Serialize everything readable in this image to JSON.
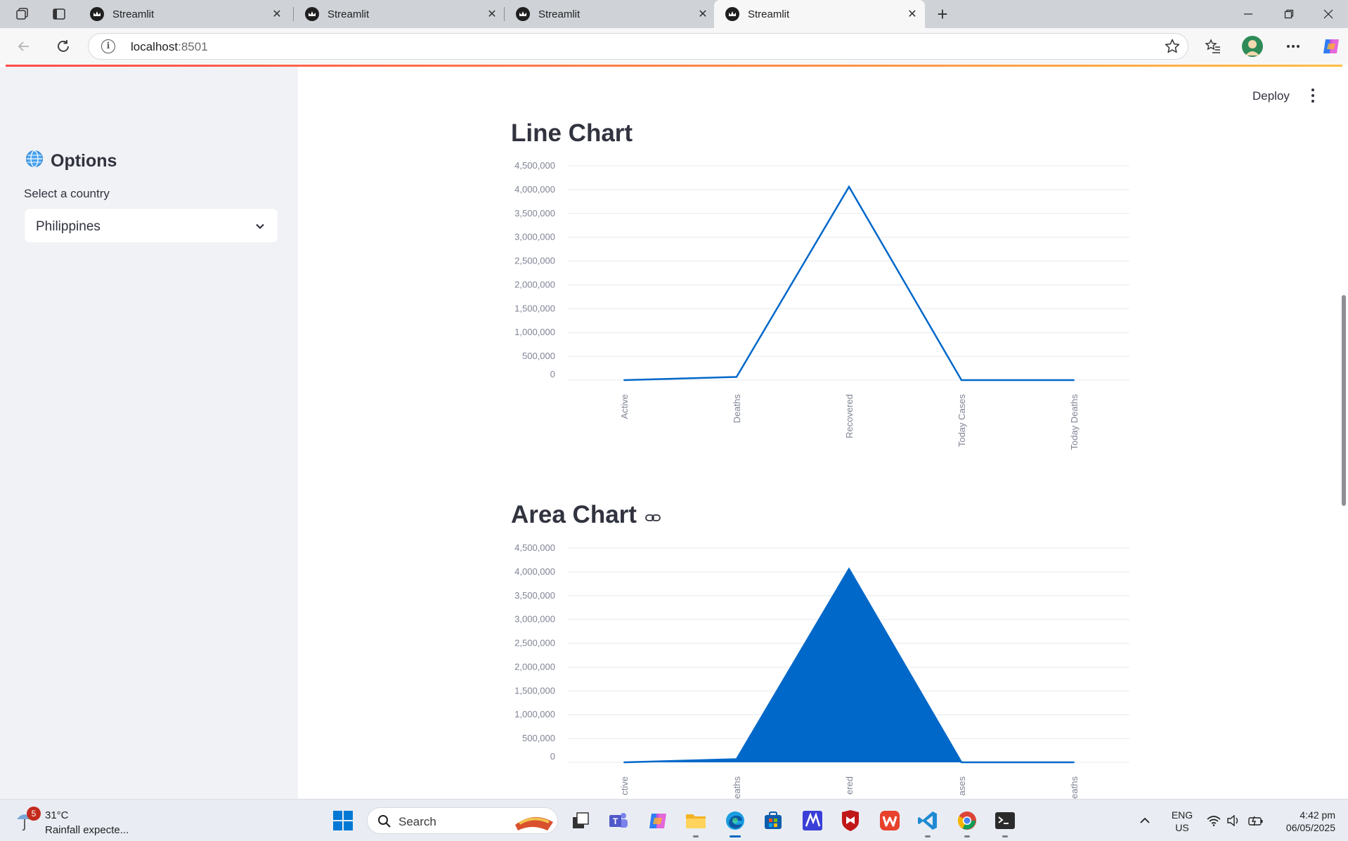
{
  "browser": {
    "tabs": [
      {
        "title": "Streamlit",
        "active": false
      },
      {
        "title": "Streamlit",
        "active": false
      },
      {
        "title": "Streamlit",
        "active": false
      },
      {
        "title": "Streamlit",
        "active": true
      }
    ],
    "url_host": "localhost",
    "url_port": ":8501"
  },
  "header": {
    "deploy_label": "Deploy"
  },
  "sidebar": {
    "title": "Options",
    "select_label": "Select a country",
    "select_value": "Philippines"
  },
  "charts": [
    {
      "heading": "Line Chart"
    },
    {
      "heading": "Area Chart"
    }
  ],
  "chart_data": [
    {
      "type": "line",
      "title": "Line Chart",
      "categories": [
        "Active",
        "Deaths",
        "Recovered",
        "Today Cases",
        "Today Deaths"
      ],
      "values": [
        0,
        66000,
        4060000,
        0,
        0
      ],
      "ylim": [
        0,
        4500000
      ],
      "yticks": [
        0,
        500000,
        1000000,
        1500000,
        2000000,
        2500000,
        3000000,
        3500000,
        4000000,
        4500000
      ],
      "ytick_labels": [
        "0",
        "500,000",
        "1,000,000",
        "1,500,000",
        "2,000,000",
        "2,500,000",
        "3,000,000",
        "3,500,000",
        "4,000,000",
        "4,500,000"
      ],
      "grid": true,
      "color": "#0068c9"
    },
    {
      "type": "area",
      "title": "Area Chart",
      "categories": [
        "Active",
        "Deaths",
        "Recovered",
        "Today Cases",
        "Today Deaths"
      ],
      "visible_tick_labels": [
        "ctive",
        "eaths",
        "ered",
        "ases",
        "eaths"
      ],
      "values": [
        0,
        66000,
        4060000,
        0,
        0
      ],
      "ylim": [
        0,
        4500000
      ],
      "yticks": [
        0,
        500000,
        1000000,
        1500000,
        2000000,
        2500000,
        3000000,
        3500000,
        4000000,
        4500000
      ],
      "ytick_labels": [
        "0",
        "500,000",
        "1,000,000",
        "1,500,000",
        "2,000,000",
        "2,500,000",
        "3,000,000",
        "3,500,000",
        "4,000,000",
        "4,500,000"
      ],
      "grid": true,
      "color": "#0068c9"
    }
  ],
  "taskbar": {
    "weather_badge": "5",
    "temperature": "31°C",
    "weather_desc": "Rainfall expecte...",
    "search_label": "Search",
    "lang_line1": "ENG",
    "lang_line2": "US",
    "time": "4:42 pm",
    "date": "06/05/2025"
  },
  "colors": {
    "accent": "#0068c9",
    "sidebar_bg": "#f0f2f6",
    "text": "#31333f",
    "axis_text": "#808495",
    "gridline": "#e6e9ef"
  },
  "icons": [
    "workspaces-icon",
    "tab-actions-icon",
    "streamlit-crown-icon",
    "close-icon",
    "new-tab-icon",
    "minimize-icon",
    "restore-icon",
    "window-close-icon",
    "back-icon",
    "refresh-icon",
    "info-icon",
    "favorite-star-icon",
    "favorites-icon",
    "profile-avatar",
    "more-icon",
    "copilot-icon",
    "globe-icon",
    "chevron-down-icon",
    "link-icon",
    "kebab-menu-icon",
    "windows-start-icon",
    "search-icon"
  ]
}
